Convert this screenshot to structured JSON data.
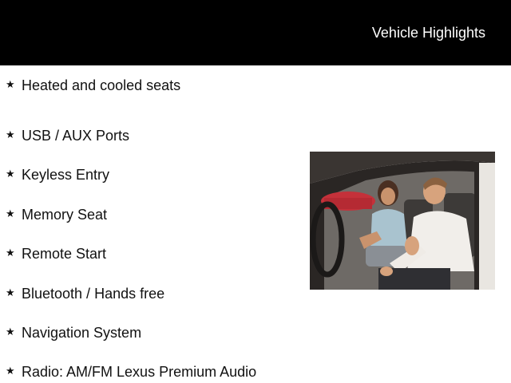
{
  "header": {
    "title": "Vehicle Highlights"
  },
  "features": [
    {
      "icon": "star-icon",
      "label": "Heated and cooled seats"
    },
    {
      "icon": "star-icon",
      "label": "USB / AUX Ports"
    },
    {
      "icon": "star-icon",
      "label": "Keyless Entry"
    },
    {
      "icon": "star-icon",
      "label": "Memory Seat"
    },
    {
      "icon": "star-icon",
      "label": "Remote Start"
    },
    {
      "icon": "star-icon",
      "label": "Bluetooth / Hands free"
    },
    {
      "icon": "star-icon",
      "label": "Navigation System"
    },
    {
      "icon": "star-icon",
      "label": "Radio: AM/FM Lexus Premium Audio"
    }
  ],
  "star_glyph": "★",
  "colors": {
    "header_bg": "#000000",
    "header_text": "#ffffff",
    "body_text": "#111111"
  }
}
